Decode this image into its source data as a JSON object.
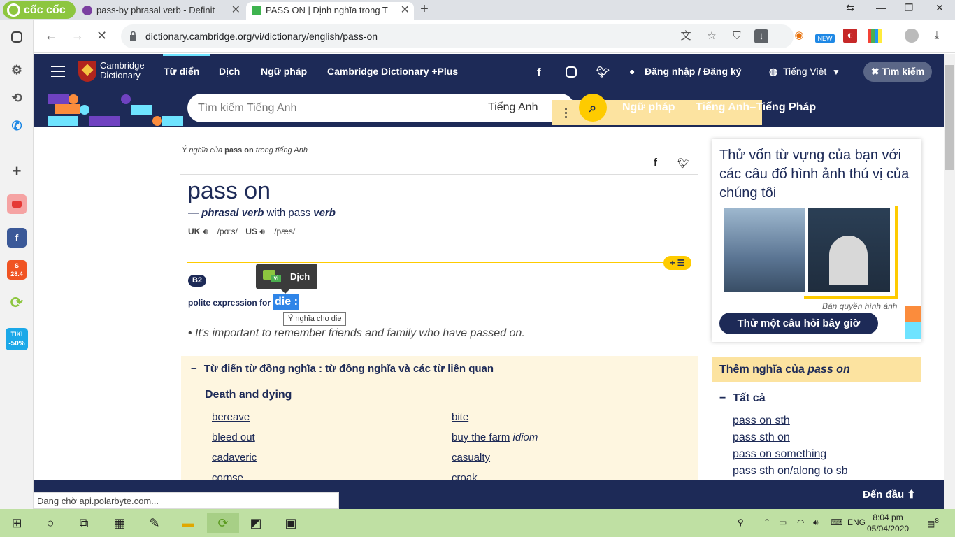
{
  "browser": {
    "brand": "cốc cốc",
    "tabs": [
      {
        "title": "pass-by phrasal verb - Definit"
      },
      {
        "title": "PASS ON | Định nghĩa trong T"
      }
    ],
    "url": "dictionary.cambridge.org/vi/dictionary/english/pass-on",
    "status": "Đang chờ api.polarbyte.com..."
  },
  "nav": {
    "logo_line1": "Cambridge",
    "logo_line2": "Dictionary",
    "links": [
      "Từ điển",
      "Dịch",
      "Ngữ pháp",
      "Cambridge Dictionary +Plus"
    ],
    "login": "Đăng nhập / Đăng ký",
    "language": "Tiếng Việt",
    "search_button": "Tìm kiếm"
  },
  "searchbar": {
    "placeholder": "Tìm kiếm Tiếng Anh",
    "lang": "Tiếng Anh",
    "link1": "Ngữ pháp",
    "link2": "Tiếng Anh–Tiếng Pháp"
  },
  "entry": {
    "crumb_pre": "Ý nghĩa của ",
    "crumb_word": "pass on",
    "crumb_post": " trong tiếng Anh",
    "headword": "pass on",
    "pos_dash": "— ",
    "pos": "phrasal verb",
    "pos_with": " with pass ",
    "pos_verb": "verb",
    "uk": "UK",
    "uk_ipa": "/pɑːs/",
    "us": "US",
    "us_ipa": "/pæs/",
    "level": "B2",
    "definition": "polite expression for",
    "selected": "die :",
    "example": "It's important to remember friends and family who have passed on.",
    "translate_label": "Dịch",
    "translate_tag": "vi",
    "hover_tip": "Ý nghĩa cho die"
  },
  "synonyms": {
    "heading": "Từ điển từ đồng nghĩa : từ đồng nghĩa và các từ liên quan",
    "category": "Death and dying",
    "col1": [
      "bereave",
      "bleed out",
      "cadaveric",
      "corpse"
    ],
    "col2": [
      "bite",
      "buy the farm",
      "casualty",
      "croak"
    ],
    "col2_idiom": "idiom"
  },
  "quiz": {
    "title": "Thử vốn từ vựng của bạn với các câu đố hình ảnh thú vị của chúng tôi",
    "copyright": "Bản quyền hình ảnh",
    "button": "Thử một câu hỏi bây giờ"
  },
  "more": {
    "label": "Thêm nghĩa của ",
    "word": "pass on",
    "all": "Tất cả",
    "links": [
      "pass on sth",
      "pass sth on",
      "pass on something",
      "pass sth on/along to sb"
    ]
  },
  "footer": {
    "to_top": "Đến đầu"
  },
  "taskbar": {
    "lang": "ENG",
    "time": "8:04 pm",
    "date": "05/04/2020",
    "notif": "8"
  },
  "sidebar": {
    "tiki": "TIKI",
    "tiki_sale": "-50%",
    "shopee_date": "28.4"
  }
}
